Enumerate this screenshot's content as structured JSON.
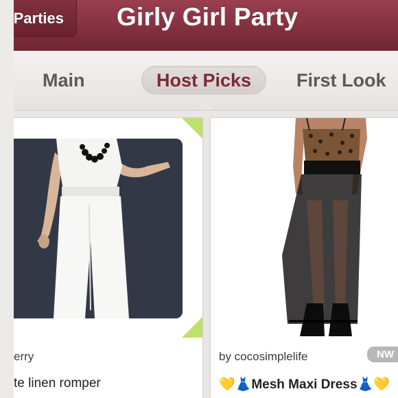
{
  "header": {
    "back_label": "Parties",
    "title": "Girly Girl Party"
  },
  "tabs": [
    {
      "label": "Main",
      "selected": false
    },
    {
      "label": "Host Picks",
      "selected": true
    },
    {
      "label": "First Look",
      "selected": false
    }
  ],
  "listings": [
    {
      "by": "erry",
      "title": "te linen romper"
    },
    {
      "by": "by cocosimplelife",
      "title": "Mesh Maxi Dress",
      "title_prefix": "💛👗",
      "title_suffix": "👗💛",
      "badge": "NW"
    }
  ],
  "colors": {
    "header": "#7d2c3b",
    "accent_text": "#7a2a38",
    "corner": "#bfe06a"
  }
}
